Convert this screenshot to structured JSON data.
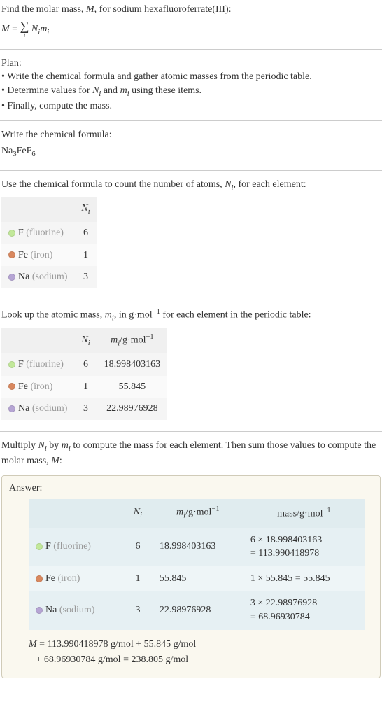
{
  "intro": {
    "line1_prefix": "Find the molar mass, ",
    "line1_M": "M",
    "line1_suffix": ", for sodium hexafluoroferrate(III):",
    "eq_M": "M",
    "eq_equals": " = ",
    "eq_sum_i": "i",
    "eq_Ni": "N",
    "eq_Ni_sub": "i",
    "eq_mi": "m",
    "eq_mi_sub": "i"
  },
  "plan": {
    "title": "Plan:",
    "b1": "• Write the chemical formula and gather atomic masses from the periodic table.",
    "b2_pre": "• Determine values for ",
    "b2_Ni": "N",
    "b2_Ni_sub": "i",
    "b2_and": " and ",
    "b2_mi": "m",
    "b2_mi_sub": "i",
    "b2_post": " using these items.",
    "b3": "• Finally, compute the mass."
  },
  "writeformula": {
    "title": "Write the chemical formula:",
    "na": "Na",
    "na_sub": "3",
    "fe": "FeF",
    "f_sub": "6"
  },
  "count": {
    "title_pre": "Use the chemical formula to count the number of atoms, ",
    "title_N": "N",
    "title_N_sub": "i",
    "title_post": ", for each element:",
    "hdr_Ni": "N",
    "hdr_Ni_sub": "i"
  },
  "elements": [
    {
      "sym": "F",
      "name": "(fluorine)",
      "dot": "dot-f",
      "N": "6",
      "m": "18.998403163"
    },
    {
      "sym": "Fe",
      "name": "(iron)",
      "dot": "dot-fe",
      "N": "1",
      "m": "55.845"
    },
    {
      "sym": "Na",
      "name": "(sodium)",
      "dot": "dot-na",
      "N": "3",
      "m": "22.98976928"
    }
  ],
  "lookup": {
    "title_pre": "Look up the atomic mass, ",
    "title_m": "m",
    "title_m_sub": "i",
    "title_mid": ", in g·mol",
    "title_exp": "−1",
    "title_post": " for each element in the periodic table:",
    "hdr_Ni": "N",
    "hdr_Ni_sub": "i",
    "hdr_mi": "m",
    "hdr_mi_sub": "i",
    "hdr_unit": "/g·mol",
    "hdr_unit_exp": "−1"
  },
  "multiply": {
    "pre": "Multiply ",
    "Ni": "N",
    "Ni_sub": "i",
    "by": " by ",
    "mi": "m",
    "mi_sub": "i",
    "mid": " to compute the mass for each element. Then sum those values to compute the molar mass, ",
    "M": "M",
    "post": ":"
  },
  "answer": {
    "title": "Answer:",
    "hdr_Ni": "N",
    "hdr_Ni_sub": "i",
    "hdr_mi": "m",
    "hdr_mi_sub": "i",
    "hdr_mi_unit": "/g·mol",
    "hdr_mi_unit_exp": "−1",
    "hdr_mass": "mass/g·mol",
    "hdr_mass_exp": "−1",
    "rows": [
      {
        "sym": "F",
        "name": "(fluorine)",
        "dot": "dot-f",
        "N": "6",
        "m": "18.998403163",
        "calc1": "6 × 18.998403163",
        "calc2": "= 113.990418978"
      },
      {
        "sym": "Fe",
        "name": "(iron)",
        "dot": "dot-fe",
        "N": "1",
        "m": "55.845",
        "calc1": "1 × 55.845 = 55.845",
        "calc2": ""
      },
      {
        "sym": "Na",
        "name": "(sodium)",
        "dot": "dot-na",
        "N": "3",
        "m": "22.98976928",
        "calc1": "3 × 22.98976928",
        "calc2": "= 68.96930784"
      }
    ],
    "final_M": "M",
    "final_line1": " = 113.990418978 g/mol + 55.845 g/mol",
    "final_line2": "+ 68.96930784 g/mol = 238.805 g/mol"
  }
}
